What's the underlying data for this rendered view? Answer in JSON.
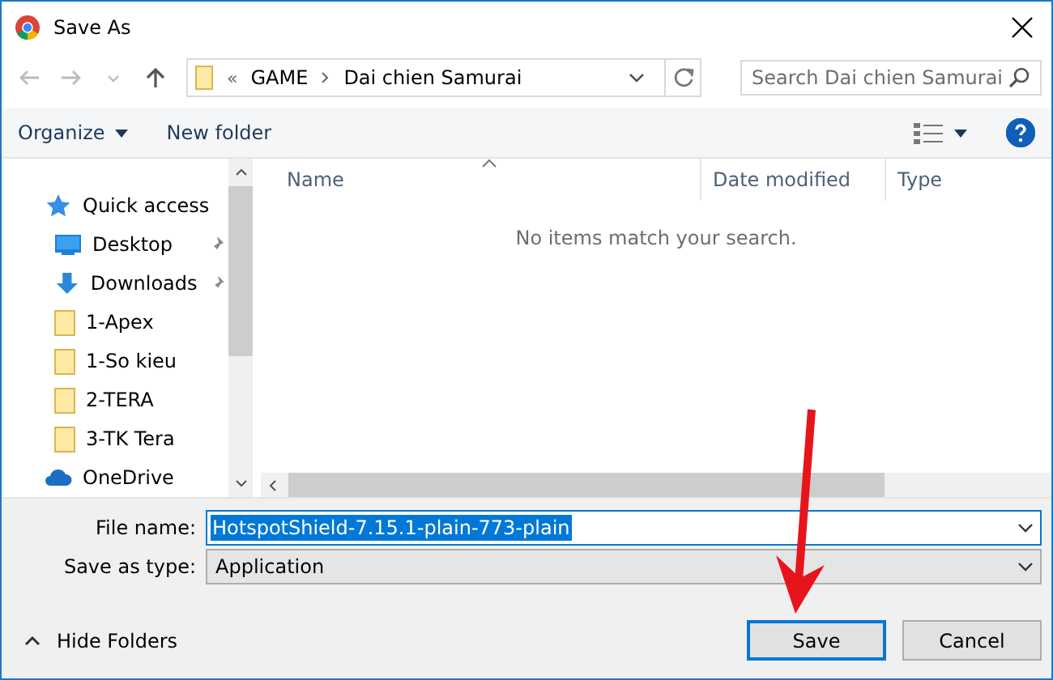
{
  "window": {
    "title": "Save As"
  },
  "address": {
    "crumbs": [
      "«",
      "GAME",
      "Dai chien Samurai"
    ]
  },
  "search": {
    "placeholder": "Search Dai chien Samurai"
  },
  "toolbar": {
    "organize": "Organize",
    "new_folder": "New folder"
  },
  "nav": {
    "items": [
      {
        "label": "Quick access",
        "kind": "star",
        "pinned": false
      },
      {
        "label": "Desktop",
        "kind": "desktop",
        "pinned": true
      },
      {
        "label": "Downloads",
        "kind": "download",
        "pinned": true
      },
      {
        "label": "1-Apex",
        "kind": "folder",
        "pinned": false
      },
      {
        "label": "1-So kieu",
        "kind": "folder",
        "pinned": false
      },
      {
        "label": "2-TERA",
        "kind": "folder",
        "pinned": false
      },
      {
        "label": "3-TK Tera",
        "kind": "folder",
        "pinned": false
      },
      {
        "label": "OneDrive",
        "kind": "cloud",
        "pinned": false
      }
    ]
  },
  "table": {
    "columns": [
      "Name",
      "Date modified",
      "Type"
    ],
    "empty_message": "No items match your search."
  },
  "form": {
    "file_name_label": "File name:",
    "file_name": "HotspotShield-7.15.1-plain-773-plain",
    "type_label": "Save as type:",
    "type": "Application"
  },
  "footer": {
    "hide_folders": "Hide Folders",
    "buttons": [
      "Save",
      "Cancel"
    ]
  }
}
